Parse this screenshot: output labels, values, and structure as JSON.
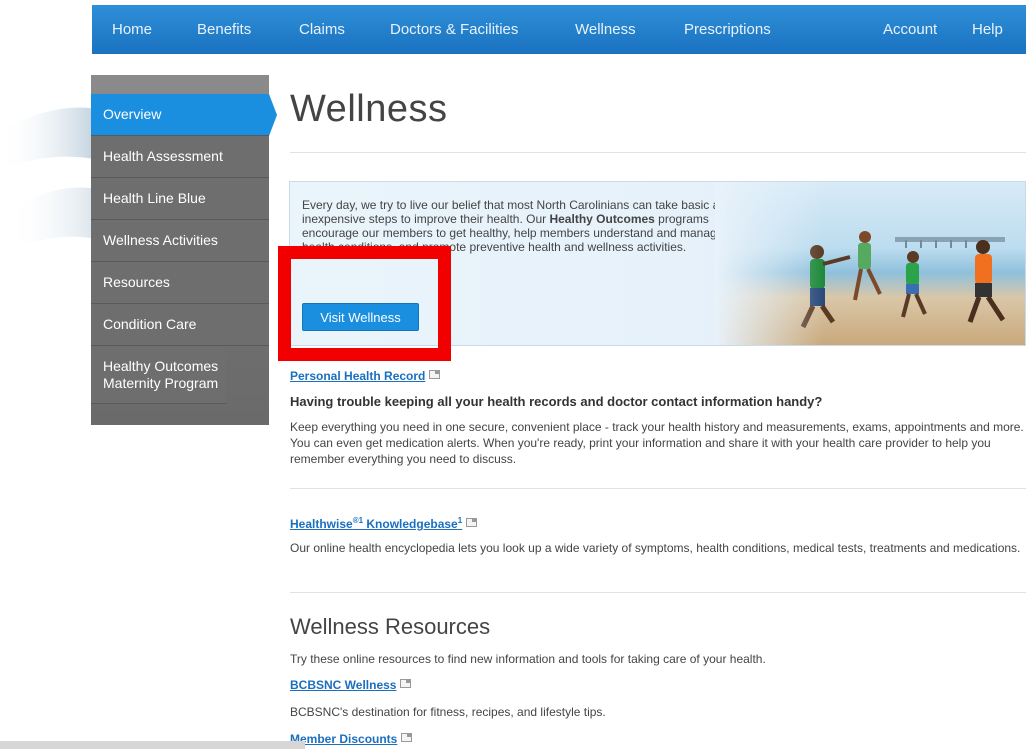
{
  "nav": {
    "items": [
      "Home",
      "Benefits",
      "Claims",
      "Doctors & Facilities",
      "Wellness",
      "Prescriptions",
      "Account",
      "Help"
    ]
  },
  "sidebar": {
    "items": [
      {
        "label": "Overview"
      },
      {
        "label": "Health Assessment"
      },
      {
        "label": "Health Line Blue"
      },
      {
        "label": "Wellness Activities"
      },
      {
        "label": "Resources"
      },
      {
        "label": "Condition Care"
      },
      {
        "label": "Healthy Outcomes Maternity Program"
      }
    ]
  },
  "main": {
    "title": "Wellness",
    "hero": {
      "text_before": "Every day, we try to live our belief that most North Carolinians can take basic and inexpensive steps to improve their health. Our ",
      "text_bold": "Healthy Outcomes",
      "text_after": " programs encourage our members to get healthy, help members understand and manage their health conditions, and promote preventive health and wellness activities.",
      "button": "Visit Wellness"
    },
    "phr": {
      "link": "Personal Health Record",
      "question": "Having trouble keeping all your health records and doctor contact information handy?",
      "body": "Keep everything you need in one secure, convenient place - track your health history and measurements, exams, appointments and more. You can even get medication alerts. When you're ready, print your information and share it with your health care provider to help you remember everything you need to discuss."
    },
    "healthwise": {
      "link_a": "Healthwise",
      "sup_a": "®1",
      "link_b": " Knowledgebase",
      "sup_b": "1",
      "body": "Our online health encyclopedia lets you look up a wide variety of symptoms, health conditions, medical tests, treatments and medications."
    },
    "resources": {
      "heading": "Wellness Resources",
      "intro": "Try these online resources to find new information and tools for taking care of your health.",
      "items": [
        {
          "link": "BCBSNC Wellness",
          "desc": "BCBSNC's destination for fitness, recipes, and lifestyle tips."
        },
        {
          "link": "Member Discounts",
          "desc": ""
        }
      ]
    }
  },
  "colors": {
    "nav": "#1a72c0",
    "accent": "#1a8fe0",
    "highlight": "#f20000"
  }
}
